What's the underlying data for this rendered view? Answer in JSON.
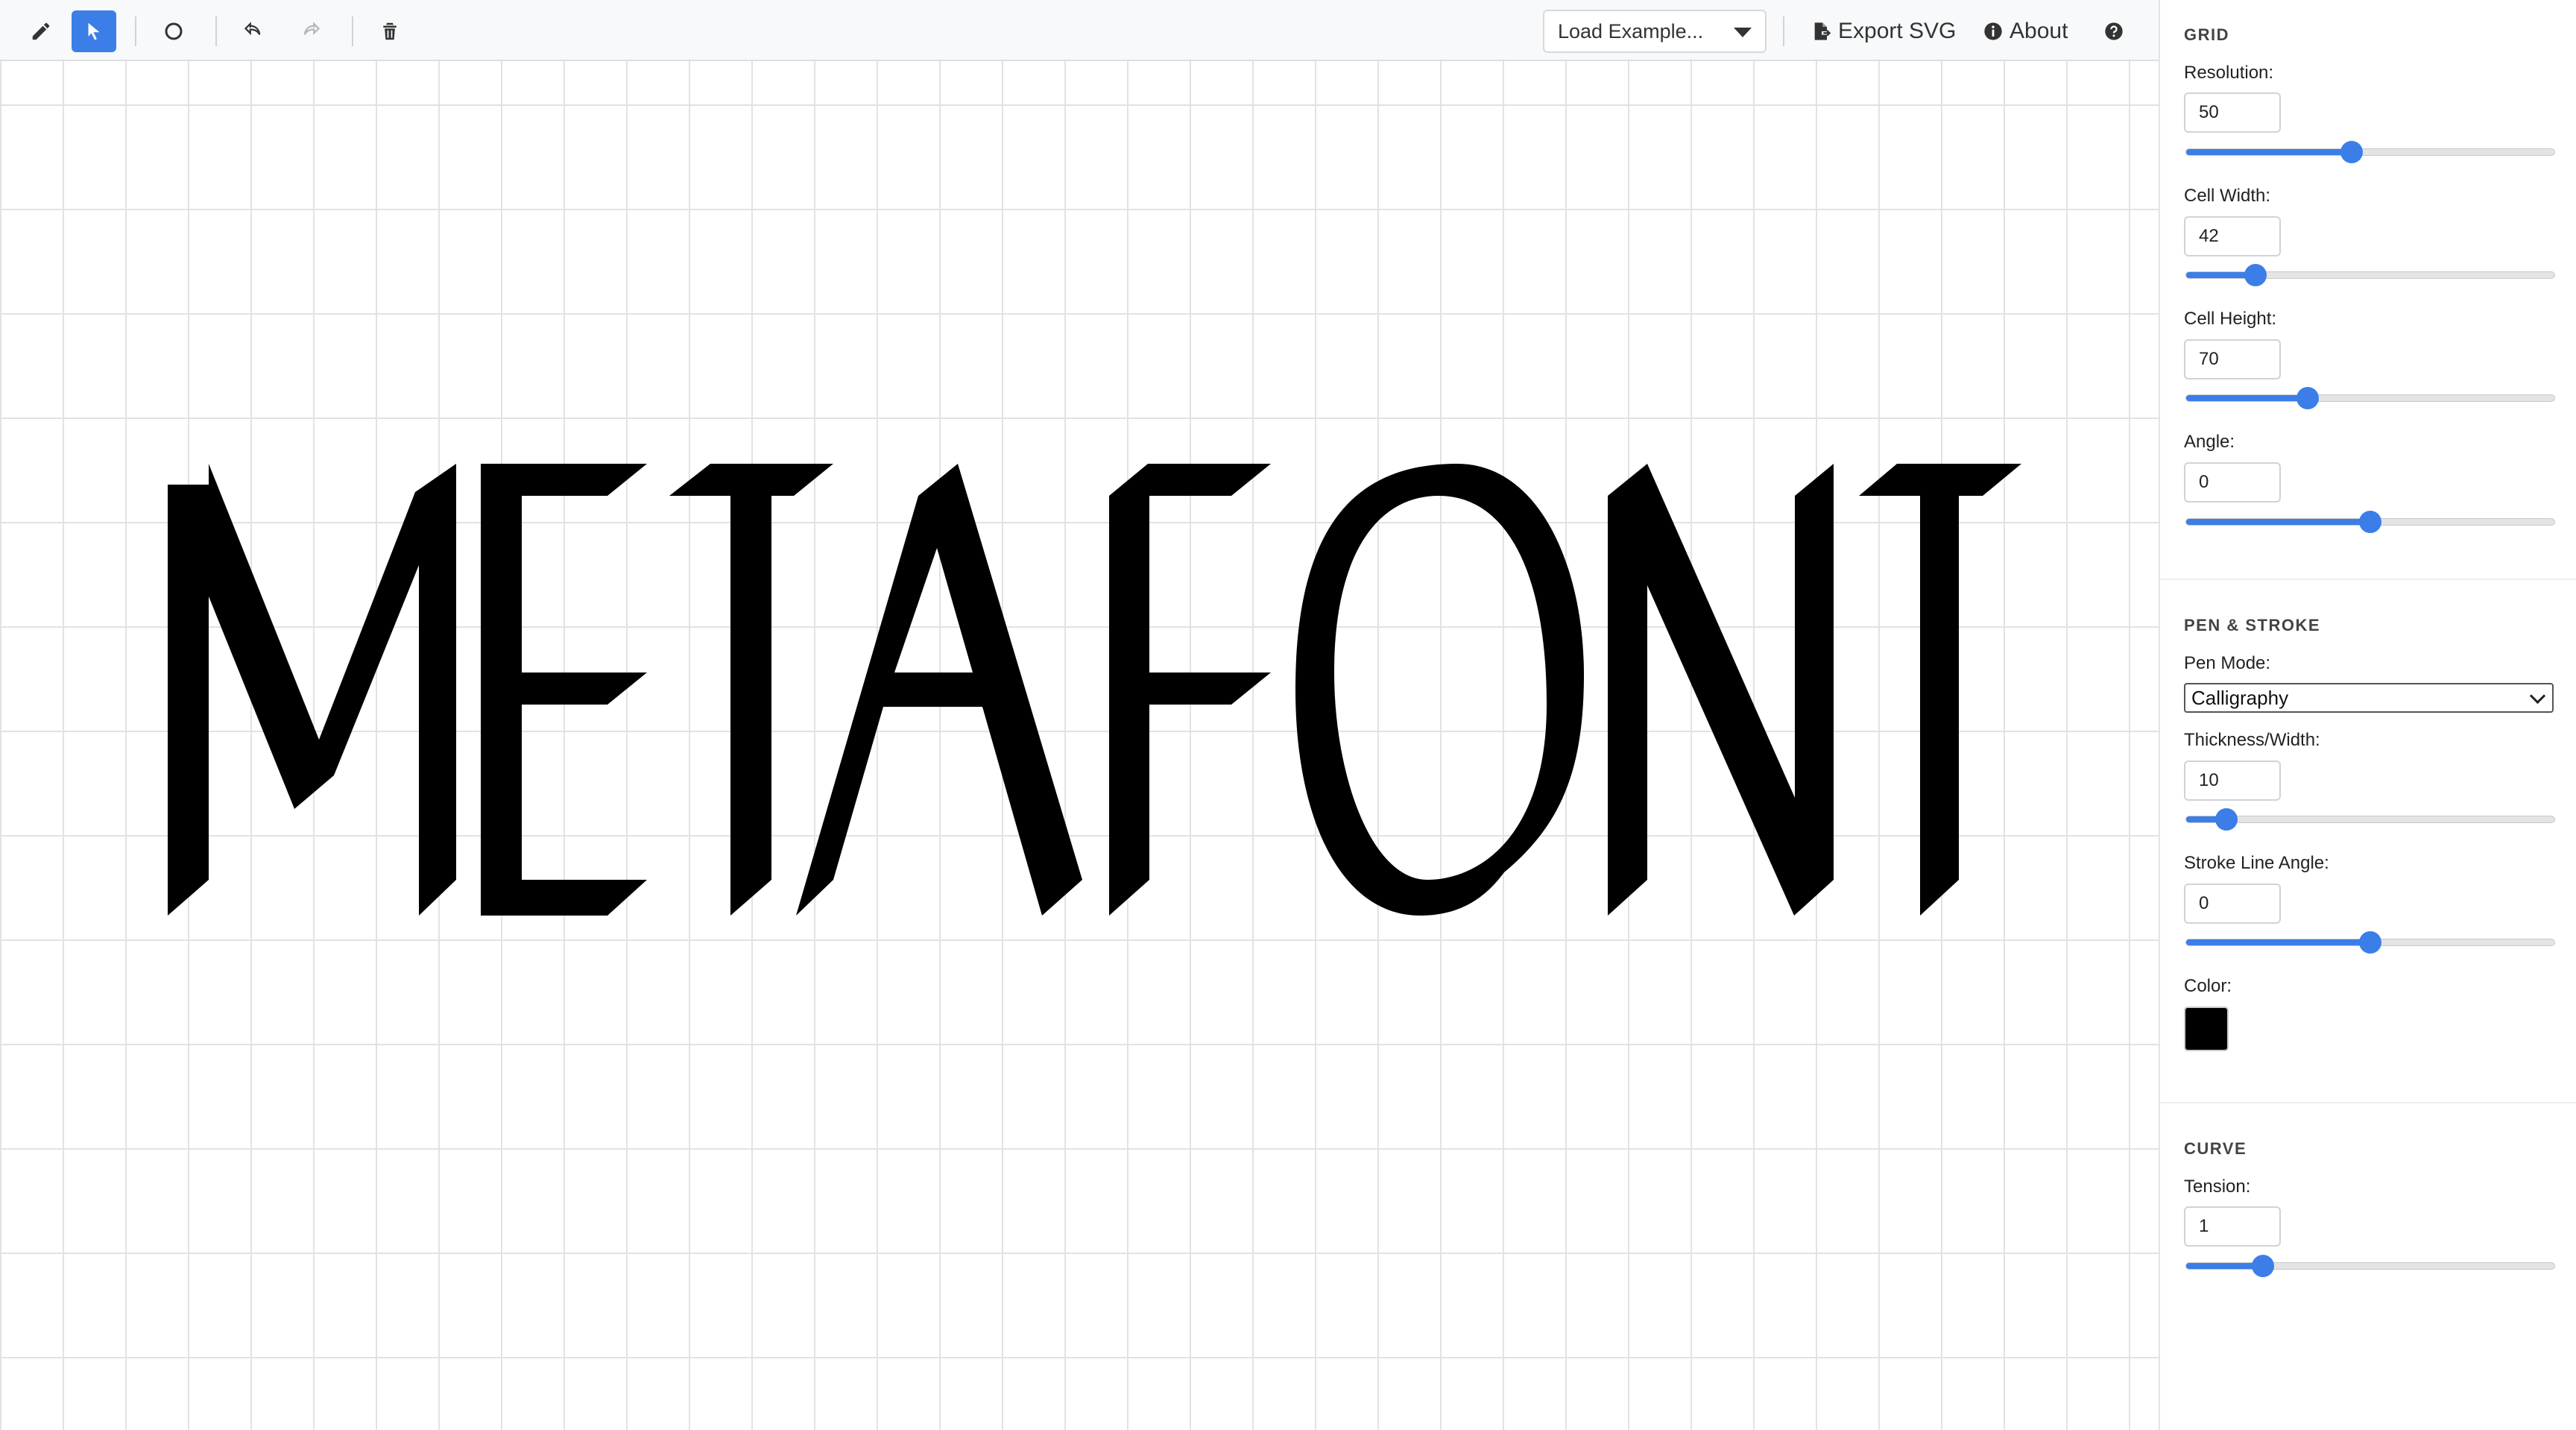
{
  "toolbar": {
    "buttons": [
      {
        "icon": "pencil-icon"
      },
      {
        "icon": "cursor-arrow-icon",
        "active": true
      },
      {
        "icon": "circle-icon"
      },
      {
        "icon": "undo-icon"
      },
      {
        "icon": "redo-icon"
      },
      {
        "icon": "trash-icon"
      }
    ],
    "load_example": "Load Example...",
    "export_svg": "Export SVG",
    "about": "About",
    "help_icon": "question-circle-icon"
  },
  "canvas": {
    "glyph_color": "#000000",
    "grid_color": "#e2e2e2"
  },
  "panel": {
    "grid": {
      "title": "GRID",
      "resolution": {
        "label": "Resolution:",
        "value": "50",
        "percent": 45
      },
      "cell_width": {
        "label": "Cell Width:",
        "value": "42",
        "percent": 19
      },
      "cell_height": {
        "label": "Cell Height:",
        "value": "70",
        "percent": 33
      },
      "angle": {
        "label": "Angle:",
        "value": "0",
        "percent": 50
      }
    },
    "pen": {
      "title": "PEN & STROKE",
      "mode": {
        "label": "Pen Mode:",
        "value": "Calligraphy"
      },
      "thickness": {
        "label": "Thickness/Width:",
        "value": "10",
        "percent": 11
      },
      "stroke_angle": {
        "label": "Stroke Line Angle:",
        "value": "0",
        "percent": 50
      },
      "color": {
        "label": "Color:",
        "value": "#000000"
      }
    },
    "curve": {
      "title": "CURVE",
      "tension": {
        "label": "Tension:",
        "value": "1",
        "percent": 21
      }
    }
  },
  "accent_color": "#3b7ee8"
}
